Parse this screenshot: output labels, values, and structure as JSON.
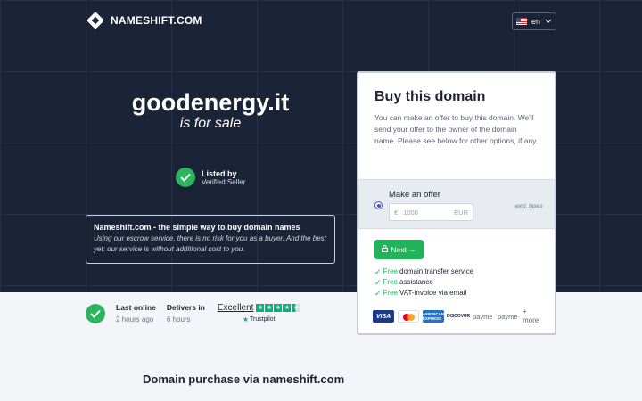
{
  "header": {
    "logo_text": "NAMESHIFT.COM",
    "language": "en"
  },
  "hero": {
    "domain_name": "goodenergy.it",
    "tagline": "is for sale",
    "listed_title": "Listed by",
    "listed_sub": "Verified Seller",
    "info_title": "Nameshift.com - the simple way to buy domain names",
    "info_body": "Using our escrow service, there is no risk for you as a buyer. And the best yet: our service is without additional cost to you."
  },
  "stats": {
    "last_online_label": "Last online",
    "last_online_value": "2 hours ago",
    "delivers_label": "Delivers in",
    "delivers_value": "6 hours",
    "trust_word": "Excellent",
    "trust_rating": 4.5,
    "trust_brand": "Trustpilot"
  },
  "card": {
    "title": "Buy this domain",
    "description": "You can make an offer to buy this domain. We'll send your offer to the owner of the domain name. Please see below for other options, if any.",
    "offer_label": "Make an offer",
    "currency_symbol": "€",
    "price_placeholder": "1000",
    "currency_code": "EUR",
    "excl_taxes": "excl. taxes",
    "next_label": "Next →",
    "features": [
      {
        "free": "Free",
        "text": "domain transfer service"
      },
      {
        "free": "Free",
        "text": "assistance"
      },
      {
        "free": "Free",
        "text": "VAT-invoice via email"
      }
    ],
    "payment": {
      "visa": "VISA",
      "amex": "AMERICAN EXPRESS",
      "discover": "DISCOVER",
      "img1": "payme",
      "img2": "payme",
      "more": "+ more"
    }
  },
  "footer": {
    "section_title": "Domain purchase via nameshift.com"
  },
  "colors": {
    "hero_bg": "#1b2336",
    "accent_green": "#22b35a",
    "radio_blue": "#4a4cc9"
  }
}
